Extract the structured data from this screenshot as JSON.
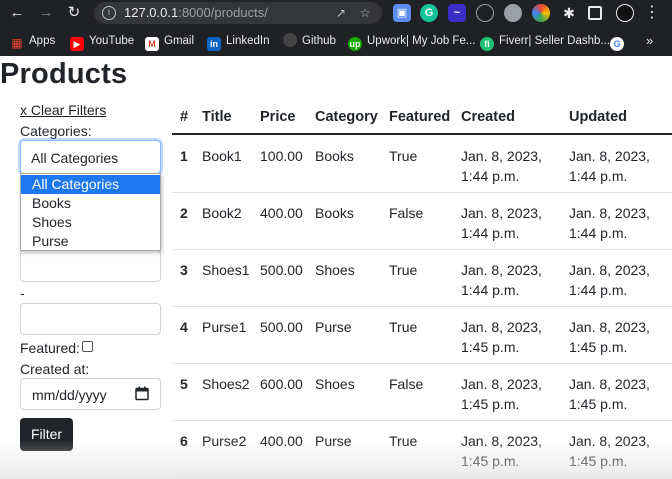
{
  "browser": {
    "url_host": "127.0.0.1",
    "url_rest": ":8000/products/",
    "bookmarks": [
      {
        "label": "Apps",
        "icon": "apps-grid-icon",
        "color": "#e8eaed"
      },
      {
        "label": "YouTube",
        "icon": "youtube-icon",
        "color": "#ff0000"
      },
      {
        "label": "Gmail",
        "icon": "gmail-icon",
        "color": "#ea4335"
      },
      {
        "label": "LinkedIn",
        "icon": "linkedin-icon",
        "color": "#0a66c2"
      },
      {
        "label": "Github",
        "icon": "github-icon",
        "color": "#444444"
      },
      {
        "label": "Upwork| My Job Fe...",
        "icon": "upwork-icon",
        "color": "#14a800"
      },
      {
        "label": "Fiverr| Seller Dashb...",
        "icon": "fiverr-icon",
        "color": "#1dbf73"
      }
    ]
  },
  "page": {
    "title": "Products"
  },
  "filters": {
    "clear_label": "x Clear Filters",
    "categories_label": "Categories:",
    "selected_category": "All Categories",
    "category_options": [
      "All Categories",
      "Books",
      "Shoes",
      "Purse"
    ],
    "range_separator": "-",
    "featured_label": "Featured:",
    "created_label": "Created at:",
    "date_placeholder": "mm/dd/yyyy",
    "filter_button": "Filter"
  },
  "table": {
    "headers": [
      "#",
      "Title",
      "Price",
      "Category",
      "Featured",
      "Created",
      "Updated"
    ],
    "rows": [
      {
        "id": "1",
        "title": "Book1",
        "price": "100.00",
        "category": "Books",
        "featured": "True",
        "created_1": "Jan. 8, 2023,",
        "created_2": "1:44 p.m.",
        "updated_1": "Jan. 8, 2023,",
        "updated_2": "1:44 p.m."
      },
      {
        "id": "2",
        "title": "Book2",
        "price": "400.00",
        "category": "Books",
        "featured": "False",
        "created_1": "Jan. 8, 2023,",
        "created_2": "1:44 p.m.",
        "updated_1": "Jan. 8, 2023,",
        "updated_2": "1:44 p.m."
      },
      {
        "id": "3",
        "title": "Shoes1",
        "price": "500.00",
        "category": "Shoes",
        "featured": "True",
        "created_1": "Jan. 8, 2023,",
        "created_2": "1:44 p.m.",
        "updated_1": "Jan. 8, 2023,",
        "updated_2": "1:44 p.m."
      },
      {
        "id": "4",
        "title": "Purse1",
        "price": "500.00",
        "category": "Purse",
        "featured": "True",
        "created_1": "Jan. 8, 2023,",
        "created_2": "1:45 p.m.",
        "updated_1": "Jan. 8, 2023,",
        "updated_2": "1:45 p.m."
      },
      {
        "id": "5",
        "title": "Shoes2",
        "price": "600.00",
        "category": "Shoes",
        "featured": "False",
        "created_1": "Jan. 8, 2023,",
        "created_2": "1:45 p.m.",
        "updated_1": "Jan. 8, 2023,",
        "updated_2": "1:45 p.m."
      },
      {
        "id": "6",
        "title": "Purse2",
        "price": "400.00",
        "category": "Purse",
        "featured": "True",
        "created_1": "Jan. 8, 2023,",
        "created_2": "1:45 p.m.",
        "updated_1": "Jan. 8, 2023,",
        "updated_2": "1:45 p.m."
      }
    ]
  }
}
